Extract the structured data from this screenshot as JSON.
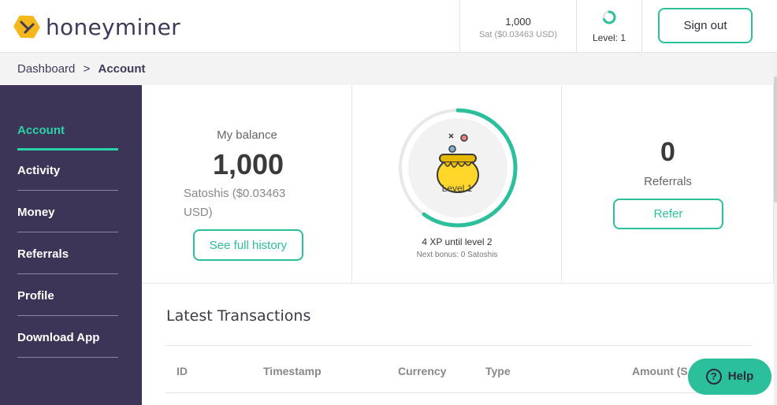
{
  "brand": {
    "name": "honeyminer"
  },
  "header": {
    "balance_value": "1,000",
    "balance_unit": "Sat ($0.03463 USD)",
    "level_label": "Level: 1",
    "signout_label": "Sign out"
  },
  "breadcrumb": {
    "root": "Dashboard",
    "separator": ">",
    "current": "Account"
  },
  "sidebar": {
    "items": [
      {
        "label": "Account",
        "active": true
      },
      {
        "label": "Activity"
      },
      {
        "label": "Money"
      },
      {
        "label": "Referrals"
      },
      {
        "label": "Profile"
      },
      {
        "label": "Download App"
      }
    ]
  },
  "balance_card": {
    "title": "My balance",
    "value": "1,000",
    "unit": "Satoshis ($0.03463 USD)",
    "button": "See full history"
  },
  "level_card": {
    "level_text": "Level 1",
    "progress_fraction": 0.6,
    "xp_text": "4 XP until level 2",
    "bonus_text": "Next bonus: 0 Satoshis"
  },
  "referrals_card": {
    "count": "0",
    "label": "Referrals",
    "button": "Refer"
  },
  "transactions": {
    "title": "Latest Transactions",
    "columns": [
      "ID",
      "Timestamp",
      "Currency",
      "Type",
      "Amount (S"
    ]
  },
  "help": {
    "label": "Help",
    "icon": "question-icon"
  },
  "colors": {
    "accent": "#2bbf9b",
    "sidebar": "#3d3557",
    "active": "#2bd3a8"
  }
}
